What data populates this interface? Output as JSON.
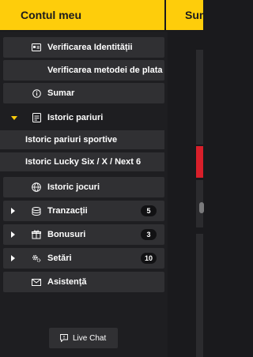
{
  "header": {
    "title": "Contul meu",
    "right_title": "Sum"
  },
  "menu": {
    "verificarea_identitatii": "Verificarea Identității",
    "verificarea_metodei": "Verificarea metodei de plata",
    "sumar": "Sumar",
    "istoric_pariuri": "Istoric pariuri",
    "istoric_pariuri_sportive": "Istoric pariuri sportive",
    "istoric_lucky_six": "Istoric Lucky Six / X / Next 6",
    "istoric_jocuri": "Istoric jocuri",
    "tranzactii": "Tranzacții",
    "tranzactii_count": "5",
    "bonusuri": "Bonusuri",
    "bonusuri_count": "3",
    "setari": "Setări",
    "setari_count": "10",
    "asistenta": "Asistență"
  },
  "live_chat": "Live Chat",
  "colors": {
    "accent": "#fecd0b",
    "background": "#1a1a1d",
    "item": "#303033",
    "alert": "#d81f2a"
  },
  "icons": {
    "verificarea_identitatii": "id-card-icon",
    "sumar": "info-icon",
    "istoric_pariuri": "ticket-icon",
    "istoric_jocuri": "globe-icon",
    "tranzactii": "coins-icon",
    "bonusuri": "gift-icon",
    "setari": "gears-icon",
    "asistenta": "mail-icon",
    "live_chat": "chat-icon"
  }
}
